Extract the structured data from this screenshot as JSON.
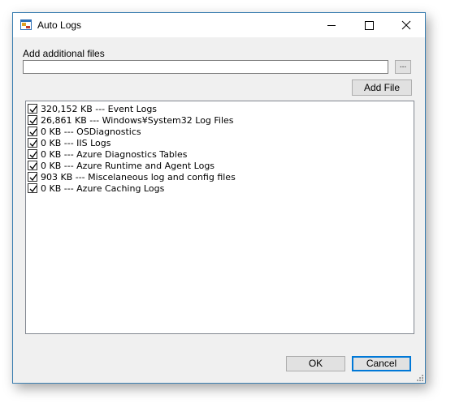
{
  "window": {
    "title": "Auto Logs",
    "controls": {
      "minimize_icon": "minimize-icon",
      "maximize_icon": "maximize-icon",
      "close_icon": "close-icon"
    }
  },
  "form": {
    "add_files_label": "Add additional files",
    "path_value": "",
    "browse_label": "...",
    "add_file_label": "Add File"
  },
  "log_items": [
    {
      "checked": true,
      "label": "320,152 KB --- Event Logs"
    },
    {
      "checked": true,
      "label": "26,861 KB --- Windows¥System32 Log Files"
    },
    {
      "checked": true,
      "label": "0 KB --- OSDiagnostics"
    },
    {
      "checked": true,
      "label": "0 KB --- IIS Logs"
    },
    {
      "checked": true,
      "label": "0 KB --- Azure Diagnostics Tables"
    },
    {
      "checked": true,
      "label": "0 KB --- Azure Runtime and Agent Logs"
    },
    {
      "checked": true,
      "label": "903 KB --- Miscelaneous log and config files"
    },
    {
      "checked": true,
      "label": "0 KB --- Azure Caching Logs"
    }
  ],
  "buttons": {
    "ok": "OK",
    "cancel": "Cancel"
  },
  "colors": {
    "accent": "#0078d7",
    "window_border": "#3c7fb1",
    "dialog_bg": "#f0f0f0"
  }
}
